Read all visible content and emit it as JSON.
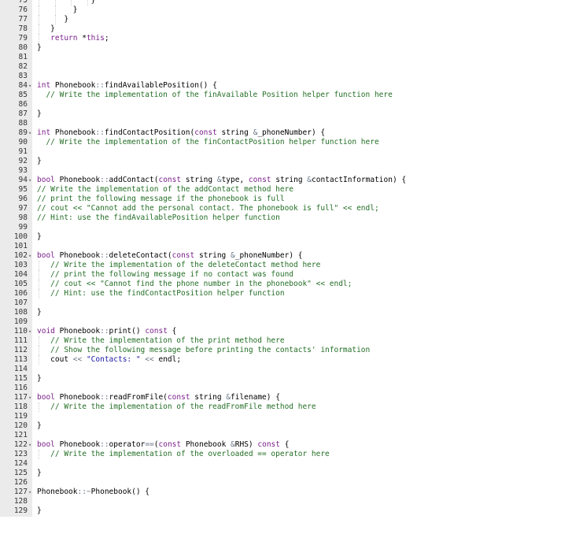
{
  "editor": {
    "colors": {
      "gutter": "#ebebeb",
      "keyword": "#7a1f8a",
      "comment": "#236e25",
      "string": "#1a1aa6",
      "operator": "#687687"
    },
    "lines": [
      {
        "n": "75",
        "indent": 12,
        "fold": false,
        "tokens": [
          [
            "tx",
            "}"
          ]
        ]
      },
      {
        "n": "76",
        "indent": 8,
        "fold": false,
        "tokens": [
          [
            "tx",
            "}"
          ]
        ]
      },
      {
        "n": "77",
        "indent": 6,
        "fold": false,
        "tokens": [
          [
            "tx",
            "}"
          ]
        ]
      },
      {
        "n": "78",
        "indent": 3,
        "fold": false,
        "tokens": [
          [
            "tx",
            "}"
          ]
        ]
      },
      {
        "n": "79",
        "indent": 3,
        "fold": false,
        "tokens": [
          [
            "kw",
            "return "
          ],
          [
            "tx",
            "*"
          ],
          [
            "kw",
            "this"
          ],
          [
            "tx",
            ";"
          ]
        ]
      },
      {
        "n": "80",
        "indent": 0,
        "fold": false,
        "tokens": [
          [
            "tx",
            "}"
          ]
        ]
      },
      {
        "n": "81",
        "indent": 0,
        "fold": false,
        "tokens": []
      },
      {
        "n": "82",
        "indent": 0,
        "fold": false,
        "tokens": []
      },
      {
        "n": "83",
        "indent": 0,
        "fold": false,
        "tokens": []
      },
      {
        "n": "84",
        "indent": 0,
        "fold": true,
        "tokens": [
          [
            "kw",
            "int "
          ],
          [
            "tx",
            "Phonebook"
          ],
          [
            "op",
            "::"
          ],
          [
            "tx",
            "findAvailablePosition() {"
          ]
        ]
      },
      {
        "n": "85",
        "indent": 2,
        "fold": false,
        "tokens": [
          [
            "cm",
            "// Write the implementation of the finAvailable Position helper function here"
          ]
        ]
      },
      {
        "n": "86",
        "indent": 0,
        "fold": false,
        "tokens": []
      },
      {
        "n": "87",
        "indent": 0,
        "fold": false,
        "tokens": [
          [
            "tx",
            "}"
          ]
        ]
      },
      {
        "n": "88",
        "indent": 0,
        "fold": false,
        "tokens": []
      },
      {
        "n": "89",
        "indent": 0,
        "fold": true,
        "tokens": [
          [
            "kw",
            "int "
          ],
          [
            "tx",
            "Phonebook"
          ],
          [
            "op",
            "::"
          ],
          [
            "tx",
            "findContactPosition("
          ],
          [
            "kw",
            "const "
          ],
          [
            "tx",
            "string "
          ],
          [
            "op",
            "&"
          ],
          [
            "tx",
            "_phoneNumber) {"
          ]
        ]
      },
      {
        "n": "90",
        "indent": 2,
        "fold": false,
        "tokens": [
          [
            "cm",
            "// Write the implementation of the finContactPosition helper function here"
          ]
        ]
      },
      {
        "n": "91",
        "indent": 0,
        "fold": false,
        "tokens": []
      },
      {
        "n": "92",
        "indent": 0,
        "fold": false,
        "tokens": [
          [
            "tx",
            "}"
          ]
        ]
      },
      {
        "n": "93",
        "indent": 0,
        "fold": false,
        "tokens": []
      },
      {
        "n": "94",
        "indent": 0,
        "fold": true,
        "tokens": [
          [
            "kw",
            "bool "
          ],
          [
            "tx",
            "Phonebook"
          ],
          [
            "op",
            "::"
          ],
          [
            "tx",
            "addContact("
          ],
          [
            "kw",
            "const "
          ],
          [
            "tx",
            "string "
          ],
          [
            "op",
            "&"
          ],
          [
            "tx",
            "type, "
          ],
          [
            "kw",
            "const "
          ],
          [
            "tx",
            "string "
          ],
          [
            "op",
            "&"
          ],
          [
            "tx",
            "contactInformation) {"
          ]
        ]
      },
      {
        "n": "95",
        "indent": 0,
        "fold": false,
        "tokens": [
          [
            "cm",
            "// Write the implementation of the addContact method here"
          ]
        ]
      },
      {
        "n": "96",
        "indent": 0,
        "fold": false,
        "tokens": [
          [
            "cm",
            "// print the following message if the phonebook is full"
          ]
        ]
      },
      {
        "n": "97",
        "indent": 0,
        "fold": false,
        "tokens": [
          [
            "cm",
            "// cout << \"Cannot add the personal contact. The phonebook is full\" << endl;"
          ]
        ]
      },
      {
        "n": "98",
        "indent": 0,
        "fold": false,
        "tokens": [
          [
            "cm",
            "// Hint: use the findAvailablePosition helper function"
          ]
        ]
      },
      {
        "n": "99",
        "indent": 0,
        "fold": false,
        "tokens": []
      },
      {
        "n": "100",
        "indent": 0,
        "fold": false,
        "tokens": [
          [
            "tx",
            "}"
          ]
        ]
      },
      {
        "n": "101",
        "indent": 0,
        "fold": false,
        "tokens": []
      },
      {
        "n": "102",
        "indent": 0,
        "fold": true,
        "tokens": [
          [
            "kw",
            "bool "
          ],
          [
            "tx",
            "Phonebook"
          ],
          [
            "op",
            "::"
          ],
          [
            "tx",
            "deleteContact("
          ],
          [
            "kw",
            "const "
          ],
          [
            "tx",
            "string "
          ],
          [
            "op",
            "&"
          ],
          [
            "tx",
            "_phoneNumber) {"
          ]
        ]
      },
      {
        "n": "103",
        "indent": 3,
        "fold": false,
        "tokens": [
          [
            "cm",
            "// Write the implementation of the deleteContact method here"
          ]
        ]
      },
      {
        "n": "104",
        "indent": 3,
        "fold": false,
        "tokens": [
          [
            "cm",
            "// print the following message if no contact was found"
          ]
        ]
      },
      {
        "n": "105",
        "indent": 3,
        "fold": false,
        "tokens": [
          [
            "cm",
            "// cout << \"Cannot find the phone number in the phonebook\" << endl;"
          ]
        ]
      },
      {
        "n": "106",
        "indent": 3,
        "fold": false,
        "tokens": [
          [
            "cm",
            "// Hint: use the findContactPosition helper function"
          ]
        ]
      },
      {
        "n": "107",
        "indent": 0,
        "fold": false,
        "tokens": []
      },
      {
        "n": "108",
        "indent": 0,
        "fold": false,
        "tokens": [
          [
            "tx",
            "}"
          ]
        ]
      },
      {
        "n": "109",
        "indent": 0,
        "fold": false,
        "tokens": []
      },
      {
        "n": "110",
        "indent": 0,
        "fold": true,
        "tokens": [
          [
            "kw",
            "void "
          ],
          [
            "tx",
            "Phonebook"
          ],
          [
            "op",
            "::"
          ],
          [
            "tx",
            "print() "
          ],
          [
            "kw",
            "const "
          ],
          [
            "tx",
            "{"
          ]
        ]
      },
      {
        "n": "111",
        "indent": 3,
        "fold": false,
        "tokens": [
          [
            "cm",
            "// Write the implementation of the print method here"
          ]
        ]
      },
      {
        "n": "112",
        "indent": 3,
        "fold": false,
        "tokens": [
          [
            "cm",
            "// Show the following message before printing the contacts' information"
          ]
        ]
      },
      {
        "n": "113",
        "indent": 3,
        "fold": false,
        "tokens": [
          [
            "tx",
            "cout "
          ],
          [
            "op",
            "<< "
          ],
          [
            "st",
            "\"Contacts: \" "
          ],
          [
            "op",
            "<< "
          ],
          [
            "tx",
            "endl;"
          ]
        ]
      },
      {
        "n": "114",
        "indent": 0,
        "fold": false,
        "tokens": []
      },
      {
        "n": "115",
        "indent": 0,
        "fold": false,
        "tokens": [
          [
            "tx",
            "}"
          ]
        ]
      },
      {
        "n": "116",
        "indent": 0,
        "fold": false,
        "tokens": []
      },
      {
        "n": "117",
        "indent": 0,
        "fold": true,
        "tokens": [
          [
            "kw",
            "bool "
          ],
          [
            "tx",
            "Phonebook"
          ],
          [
            "op",
            "::"
          ],
          [
            "tx",
            "readFromFile("
          ],
          [
            "kw",
            "const "
          ],
          [
            "tx",
            "string "
          ],
          [
            "op",
            "&"
          ],
          [
            "tx",
            "filename) {"
          ]
        ]
      },
      {
        "n": "118",
        "indent": 3,
        "fold": false,
        "tokens": [
          [
            "cm",
            "// Write the implementation of the readFromFile method here"
          ]
        ]
      },
      {
        "n": "119",
        "indent": 0,
        "fold": false,
        "tokens": []
      },
      {
        "n": "120",
        "indent": 0,
        "fold": false,
        "tokens": [
          [
            "tx",
            "}"
          ]
        ]
      },
      {
        "n": "121",
        "indent": 0,
        "fold": false,
        "tokens": []
      },
      {
        "n": "122",
        "indent": 0,
        "fold": true,
        "tokens": [
          [
            "kw",
            "bool "
          ],
          [
            "tx",
            "Phonebook"
          ],
          [
            "op",
            "::"
          ],
          [
            "tx",
            "operator"
          ],
          [
            "op",
            "=="
          ],
          [
            "tx",
            "("
          ],
          [
            "kw",
            "const "
          ],
          [
            "tx",
            "Phonebook "
          ],
          [
            "op",
            "&"
          ],
          [
            "tx",
            "RHS) "
          ],
          [
            "kw",
            "const "
          ],
          [
            "tx",
            "{"
          ]
        ]
      },
      {
        "n": "123",
        "indent": 3,
        "fold": false,
        "tokens": [
          [
            "cm",
            "// Write the implementation of the overloaded == operator here"
          ]
        ]
      },
      {
        "n": "124",
        "indent": 0,
        "fold": false,
        "tokens": []
      },
      {
        "n": "125",
        "indent": 0,
        "fold": false,
        "tokens": [
          [
            "tx",
            "}"
          ]
        ]
      },
      {
        "n": "126",
        "indent": 0,
        "fold": false,
        "tokens": []
      },
      {
        "n": "127",
        "indent": 0,
        "fold": true,
        "tokens": [
          [
            "tx",
            "Phonebook"
          ],
          [
            "op",
            "::~"
          ],
          [
            "tx",
            "Phonebook() {"
          ]
        ]
      },
      {
        "n": "128",
        "indent": 0,
        "fold": false,
        "tokens": []
      },
      {
        "n": "129",
        "indent": 0,
        "fold": false,
        "tokens": [
          [
            "tx",
            "}"
          ]
        ]
      }
    ]
  }
}
